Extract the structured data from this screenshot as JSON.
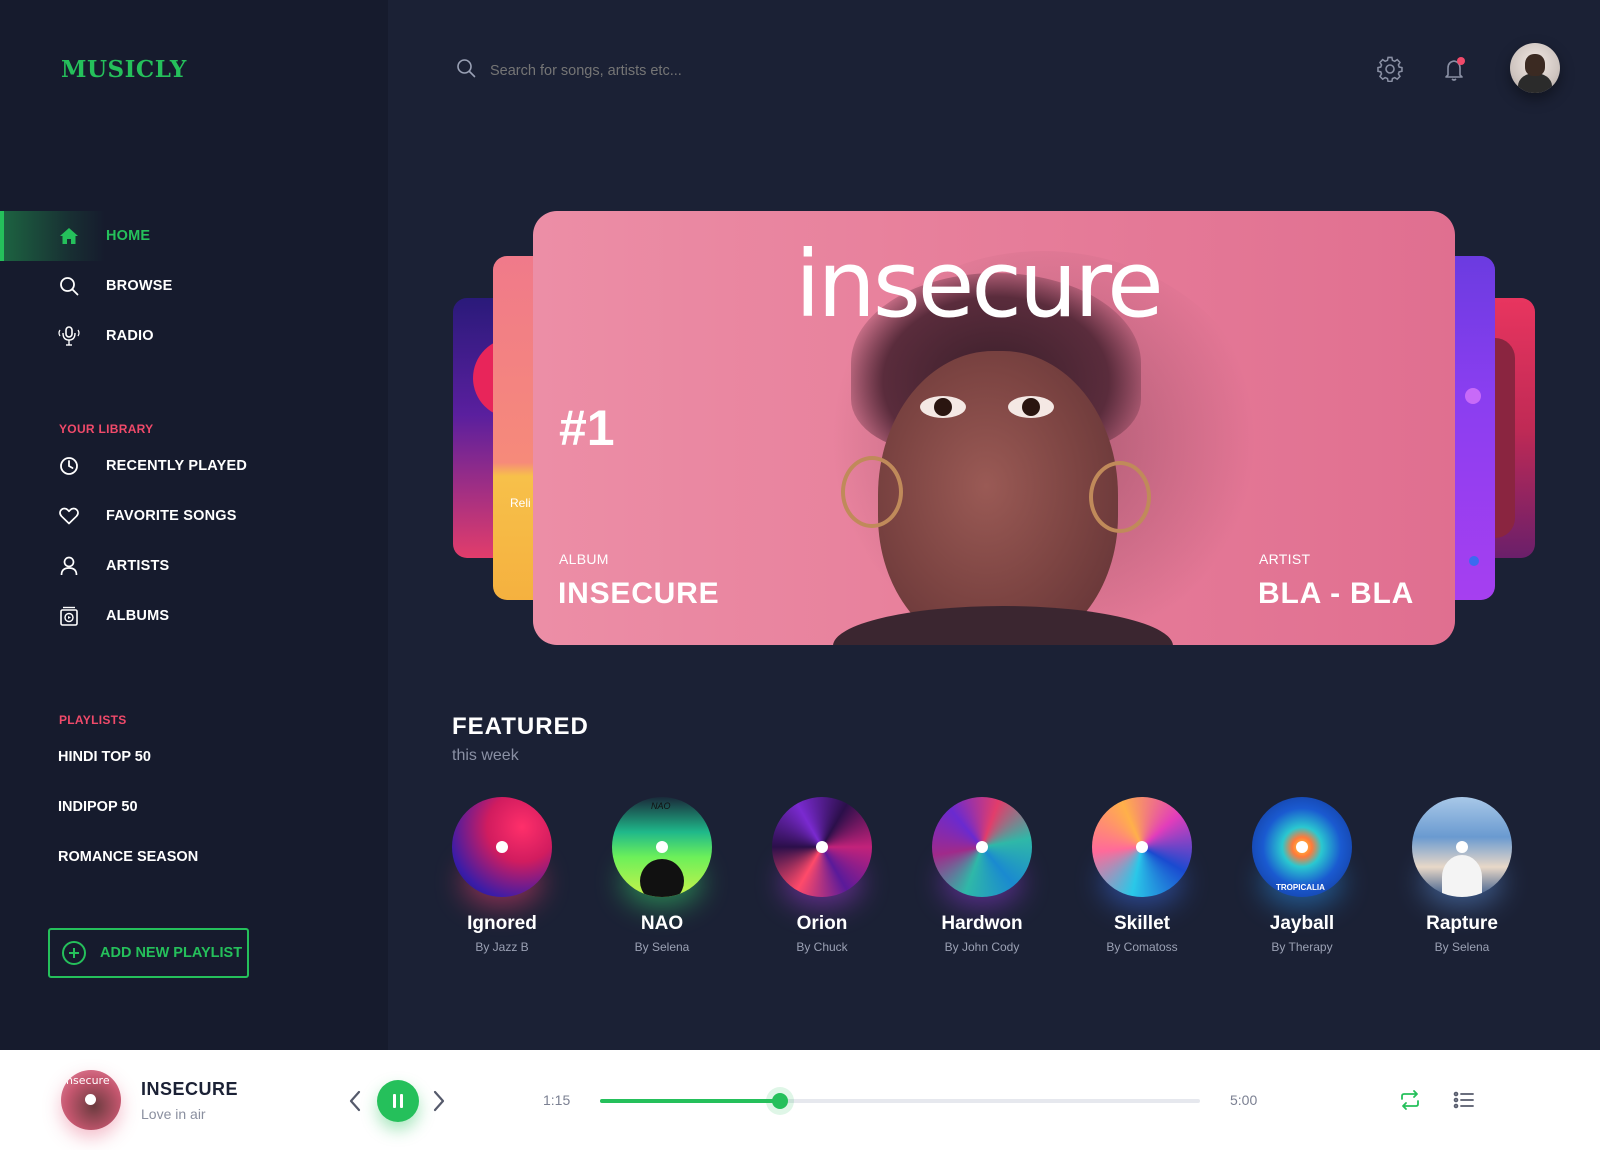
{
  "app": {
    "logo": "MUSICLY"
  },
  "search": {
    "placeholder": "Search for songs, artists etc..."
  },
  "header": {
    "icons": [
      "gear-icon",
      "bell-icon"
    ],
    "notification_dot_color": "#f04a6a"
  },
  "sidebar": {
    "nav": [
      {
        "label": "HOME",
        "icon": "home-icon",
        "active": true
      },
      {
        "label": "BROWSE",
        "icon": "search-icon"
      },
      {
        "label": "RADIO",
        "icon": "radio-mic-icon"
      }
    ],
    "library_title": "YOUR LIBRARY",
    "library": [
      {
        "label": "RECENTLY PLAYED",
        "icon": "clock-icon"
      },
      {
        "label": "FAVORITE SONGS",
        "icon": "heart-icon"
      },
      {
        "label": "ARTISTS",
        "icon": "user-icon"
      },
      {
        "label": "ALBUMS",
        "icon": "album-icon"
      }
    ],
    "playlists_title": "PLAYLISTS",
    "playlists": [
      "HINDI TOP 50",
      "INDIPOP 50",
      "ROMANCE SEASON"
    ],
    "add_playlist": "ADD NEW PLAYLIST"
  },
  "hero": {
    "title": "insecure",
    "rank": "#1",
    "album_caption": "ALBUM",
    "album": "INSECURE",
    "artist_caption": "ARTIST",
    "artist": "BLA - BLA",
    "side_card_text": "Reli"
  },
  "featured": {
    "title": "FEATURED",
    "subtitle": "this week",
    "items": [
      {
        "name": "Ignored",
        "by": "By Jazz B"
      },
      {
        "name": "NAO",
        "by": "By Selena",
        "art_text": "NAO"
      },
      {
        "name": "Orion",
        "by": "By Chuck"
      },
      {
        "name": "Hardwon",
        "by": "By John Cody"
      },
      {
        "name": "Skillet",
        "by": "By Comatoss"
      },
      {
        "name": "Jayball",
        "by": "By Therapy",
        "art_text": "TROPICALIA"
      },
      {
        "name": "Rapture",
        "by": "By Selena"
      }
    ]
  },
  "player": {
    "title": "INSECURE",
    "subtitle": "Love in air",
    "art_text": "insecure",
    "current_time": "1:15",
    "total_time": "5:00",
    "progress": 0.3,
    "state": "playing",
    "accent": "#25c05b"
  }
}
